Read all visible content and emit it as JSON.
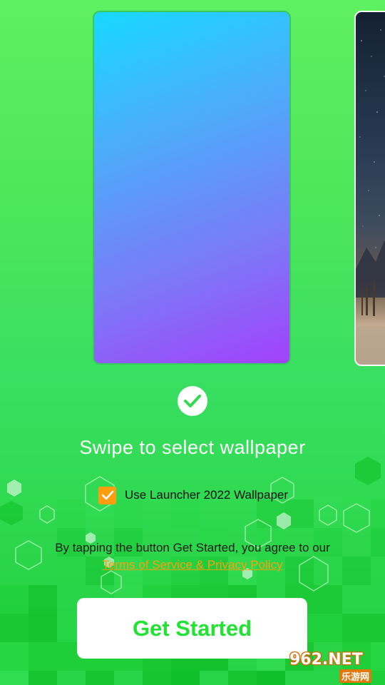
{
  "colors": {
    "accent_orange": "#ff9d0f",
    "brand_green": "#22e233",
    "background_green": "#4de65a"
  },
  "wallpapers": [
    {
      "name": "gradient-blue-purple",
      "selected": true
    },
    {
      "name": "night-sky-landscape",
      "selected": false
    }
  ],
  "selection_icon": "check-circle-icon",
  "swipe_label": "Swipe to select wallpaper",
  "checkbox": {
    "label": "Use Launcher 2022 Wallpaper",
    "checked": true,
    "icon": "checkmark-icon"
  },
  "terms": {
    "text": "By tapping the button Get Started, you agree to our",
    "link": "Terms of Service & Privacy Policy"
  },
  "cta": {
    "label": "Get Started"
  },
  "watermark": {
    "main": "962.NET",
    "sub": "乐游网"
  }
}
